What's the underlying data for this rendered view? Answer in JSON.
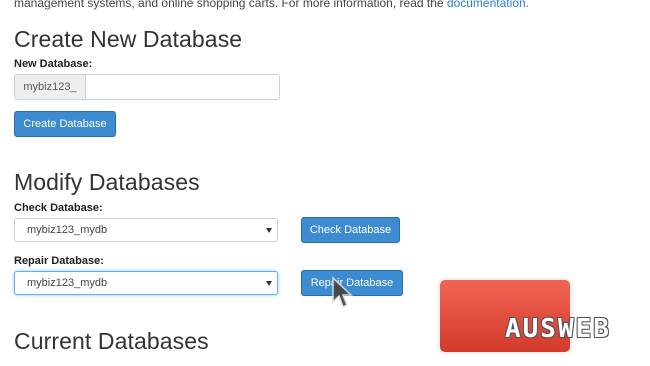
{
  "intro": {
    "text": "management systems, and online shopping carts. For more information, read the ",
    "link": "documentation."
  },
  "create": {
    "heading": "Create New Database",
    "label": "New Database:",
    "prefix": "mybiz123_",
    "value": "",
    "button": "Create Database"
  },
  "modify": {
    "heading": "Modify Databases",
    "check_label": "Check Database:",
    "check_selected": "mybiz123_mydb",
    "check_button": "Check Database",
    "repair_label": "Repair Database:",
    "repair_selected": "mybiz123_mydb",
    "repair_button": "Repair Database"
  },
  "current": {
    "heading": "Current Databases"
  },
  "watermark": {
    "text": "AUSWEB",
    "color": "#e84c3d"
  }
}
